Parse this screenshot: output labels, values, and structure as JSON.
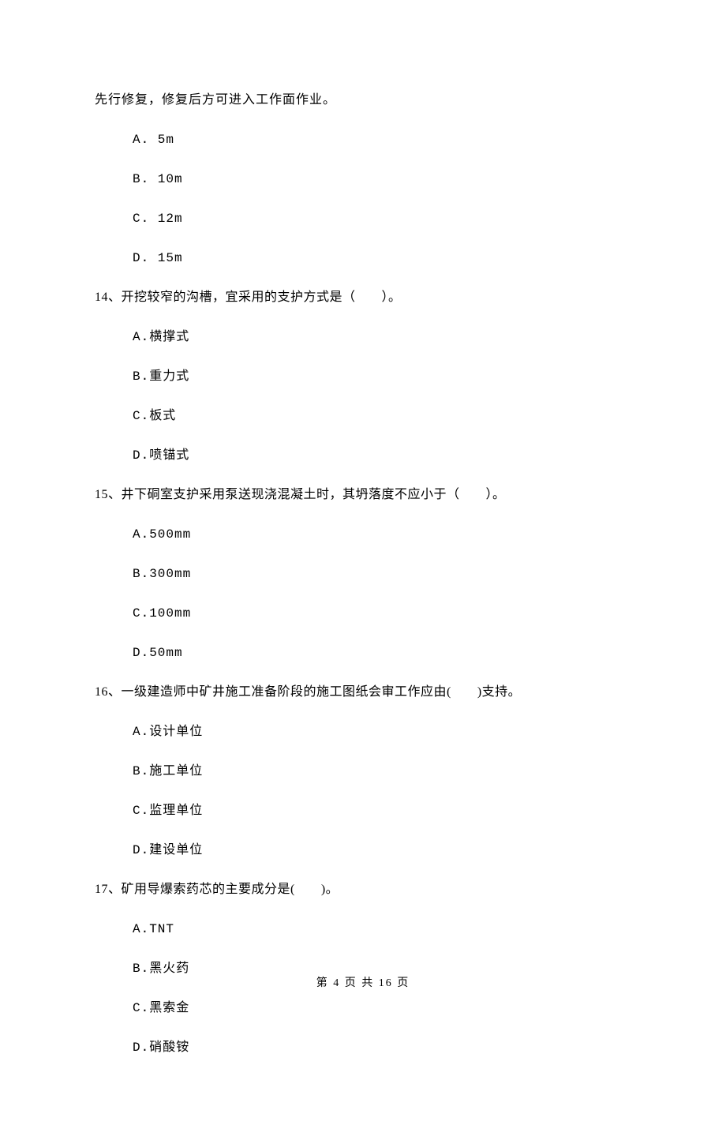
{
  "carryOver": "先行修复，修复后方可进入工作面作业。",
  "q13": {
    "options": {
      "a": "A. 5m",
      "b": "B. 10m",
      "c": "C. 12m",
      "d": "D. 15m"
    }
  },
  "q14": {
    "text": "14、开挖较窄的沟槽，宜采用的支护方式是（　　）。",
    "options": {
      "a": "A.横撑式",
      "b": "B.重力式",
      "c": "C.板式",
      "d": "D.喷锚式"
    }
  },
  "q15": {
    "text": "15、井下硐室支护采用泵送现浇混凝土时，其坍落度不应小于（　　）。",
    "options": {
      "a": "A.500mm",
      "b": "B.300mm",
      "c": "C.100mm",
      "d": "D.50mm"
    }
  },
  "q16": {
    "text": "16、一级建造师中矿井施工准备阶段的施工图纸会审工作应由(　　)支持。",
    "options": {
      "a": "A.设计单位",
      "b": "B.施工单位",
      "c": "C.监理单位",
      "d": "D.建设单位"
    }
  },
  "q17": {
    "text": "17、矿用导爆索药芯的主要成分是(　　)。",
    "options": {
      "a": "A.TNT",
      "b": "B.黑火药",
      "c": "C.黑索金",
      "d": "D.硝酸铵"
    }
  },
  "footer": "第 4 页 共 16 页"
}
